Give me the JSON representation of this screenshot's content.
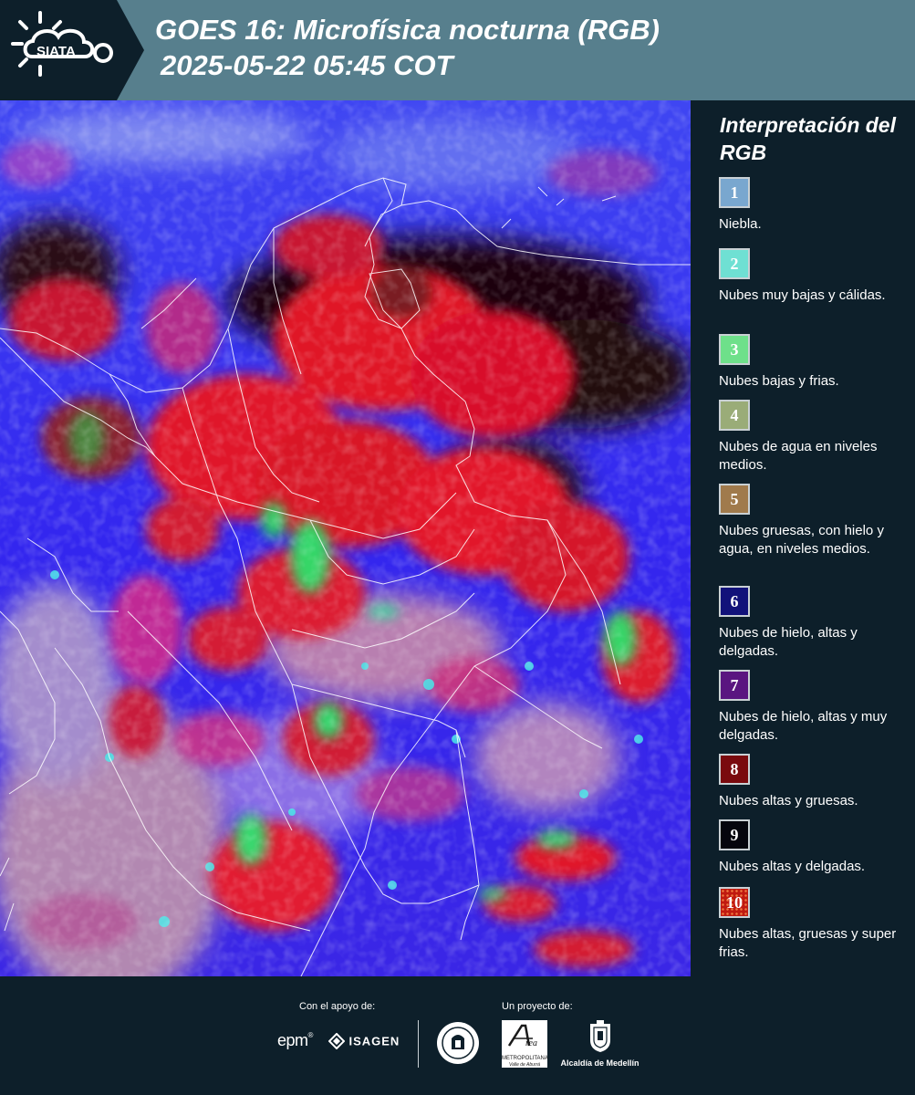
{
  "header": {
    "logo_text": "SIATA",
    "title_line1": "GOES 16: Microfísica nocturna (RGB)",
    "title_line2": "2025-05-22 05:45 COT"
  },
  "legend": {
    "title": "Interpretación del RGB",
    "items": [
      {
        "number": "1",
        "label": "Niebla.",
        "color": "#79a7cf"
      },
      {
        "number": "2",
        "label": "Nubes muy bajas y cálidas.",
        "color": "#6fe0d3"
      },
      {
        "number": "3",
        "label": "Nubes bajas y frias.",
        "color": "#6ee08a"
      },
      {
        "number": "4",
        "label": "Nubes de agua en niveles medios.",
        "color": "#9aac78"
      },
      {
        "number": "5",
        "label": "Nubes gruesas, con hielo y agua, en niveles medios.",
        "color": "#a07a4c"
      },
      {
        "number": "6",
        "label": "Nubes de hielo, altas y delgadas.",
        "color": "#12127a"
      },
      {
        "number": "7",
        "label": "Nubes de hielo, altas y muy delgadas.",
        "color": "#5a1580"
      },
      {
        "number": "8",
        "label": "Nubes altas y gruesas.",
        "color": "#7a0a0e"
      },
      {
        "number": "9",
        "label": "Nubes altas y delgadas.",
        "color": "#05050d"
      },
      {
        "number": "10",
        "label": "Nubes altas, gruesas y super frias.",
        "color": "#c01a10"
      }
    ]
  },
  "footer": {
    "support_caption": "Con el apoyo de:",
    "project_caption": "Un proyecto de:",
    "epm_logo": "epm",
    "isagen_logo": "ISAGEN",
    "area_logo_top": "METROPOLITANA",
    "area_logo_bottom": "Valle de Aburrá",
    "medellin_logo": "Alcaldía de Medellín"
  },
  "map": {
    "colors": {
      "background_blue": "#3a2af0",
      "deep_convection_red": "#e0122a",
      "dark_cloud": "#1a0508",
      "low_cloud_green": "#29e36a",
      "fog_pink": "#d59aa8",
      "cyan": "#3fe0e8",
      "boundary": "#ffffff"
    }
  }
}
